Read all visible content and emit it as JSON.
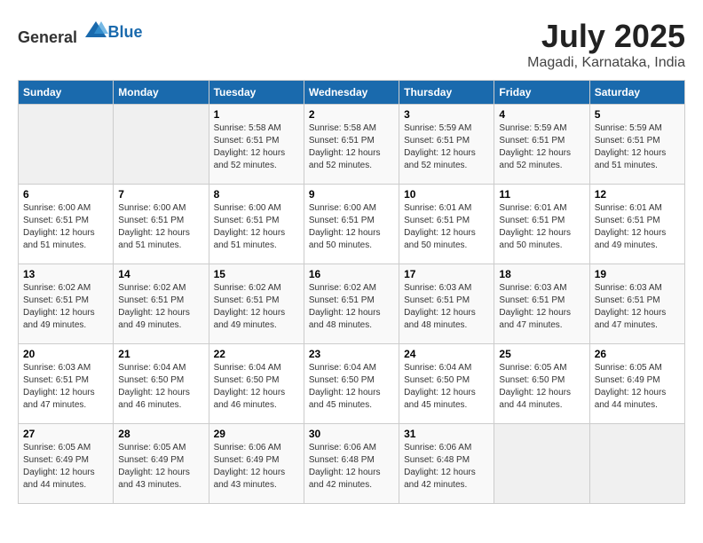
{
  "header": {
    "logo_general": "General",
    "logo_blue": "Blue",
    "title": "July 2025",
    "location": "Magadi, Karnataka, India"
  },
  "days_of_week": [
    "Sunday",
    "Monday",
    "Tuesday",
    "Wednesday",
    "Thursday",
    "Friday",
    "Saturday"
  ],
  "weeks": [
    [
      {
        "day": "",
        "empty": true
      },
      {
        "day": "",
        "empty": true
      },
      {
        "day": "1",
        "sunrise": "5:58 AM",
        "sunset": "6:51 PM",
        "daylight": "12 hours and 52 minutes."
      },
      {
        "day": "2",
        "sunrise": "5:58 AM",
        "sunset": "6:51 PM",
        "daylight": "12 hours and 52 minutes."
      },
      {
        "day": "3",
        "sunrise": "5:59 AM",
        "sunset": "6:51 PM",
        "daylight": "12 hours and 52 minutes."
      },
      {
        "day": "4",
        "sunrise": "5:59 AM",
        "sunset": "6:51 PM",
        "daylight": "12 hours and 52 minutes."
      },
      {
        "day": "5",
        "sunrise": "5:59 AM",
        "sunset": "6:51 PM",
        "daylight": "12 hours and 51 minutes."
      }
    ],
    [
      {
        "day": "6",
        "sunrise": "6:00 AM",
        "sunset": "6:51 PM",
        "daylight": "12 hours and 51 minutes."
      },
      {
        "day": "7",
        "sunrise": "6:00 AM",
        "sunset": "6:51 PM",
        "daylight": "12 hours and 51 minutes."
      },
      {
        "day": "8",
        "sunrise": "6:00 AM",
        "sunset": "6:51 PM",
        "daylight": "12 hours and 51 minutes."
      },
      {
        "day": "9",
        "sunrise": "6:00 AM",
        "sunset": "6:51 PM",
        "daylight": "12 hours and 50 minutes."
      },
      {
        "day": "10",
        "sunrise": "6:01 AM",
        "sunset": "6:51 PM",
        "daylight": "12 hours and 50 minutes."
      },
      {
        "day": "11",
        "sunrise": "6:01 AM",
        "sunset": "6:51 PM",
        "daylight": "12 hours and 50 minutes."
      },
      {
        "day": "12",
        "sunrise": "6:01 AM",
        "sunset": "6:51 PM",
        "daylight": "12 hours and 49 minutes."
      }
    ],
    [
      {
        "day": "13",
        "sunrise": "6:02 AM",
        "sunset": "6:51 PM",
        "daylight": "12 hours and 49 minutes."
      },
      {
        "day": "14",
        "sunrise": "6:02 AM",
        "sunset": "6:51 PM",
        "daylight": "12 hours and 49 minutes."
      },
      {
        "day": "15",
        "sunrise": "6:02 AM",
        "sunset": "6:51 PM",
        "daylight": "12 hours and 49 minutes."
      },
      {
        "day": "16",
        "sunrise": "6:02 AM",
        "sunset": "6:51 PM",
        "daylight": "12 hours and 48 minutes."
      },
      {
        "day": "17",
        "sunrise": "6:03 AM",
        "sunset": "6:51 PM",
        "daylight": "12 hours and 48 minutes."
      },
      {
        "day": "18",
        "sunrise": "6:03 AM",
        "sunset": "6:51 PM",
        "daylight": "12 hours and 47 minutes."
      },
      {
        "day": "19",
        "sunrise": "6:03 AM",
        "sunset": "6:51 PM",
        "daylight": "12 hours and 47 minutes."
      }
    ],
    [
      {
        "day": "20",
        "sunrise": "6:03 AM",
        "sunset": "6:51 PM",
        "daylight": "12 hours and 47 minutes."
      },
      {
        "day": "21",
        "sunrise": "6:04 AM",
        "sunset": "6:50 PM",
        "daylight": "12 hours and 46 minutes."
      },
      {
        "day": "22",
        "sunrise": "6:04 AM",
        "sunset": "6:50 PM",
        "daylight": "12 hours and 46 minutes."
      },
      {
        "day": "23",
        "sunrise": "6:04 AM",
        "sunset": "6:50 PM",
        "daylight": "12 hours and 45 minutes."
      },
      {
        "day": "24",
        "sunrise": "6:04 AM",
        "sunset": "6:50 PM",
        "daylight": "12 hours and 45 minutes."
      },
      {
        "day": "25",
        "sunrise": "6:05 AM",
        "sunset": "6:50 PM",
        "daylight": "12 hours and 44 minutes."
      },
      {
        "day": "26",
        "sunrise": "6:05 AM",
        "sunset": "6:49 PM",
        "daylight": "12 hours and 44 minutes."
      }
    ],
    [
      {
        "day": "27",
        "sunrise": "6:05 AM",
        "sunset": "6:49 PM",
        "daylight": "12 hours and 44 minutes."
      },
      {
        "day": "28",
        "sunrise": "6:05 AM",
        "sunset": "6:49 PM",
        "daylight": "12 hours and 43 minutes."
      },
      {
        "day": "29",
        "sunrise": "6:06 AM",
        "sunset": "6:49 PM",
        "daylight": "12 hours and 43 minutes."
      },
      {
        "day": "30",
        "sunrise": "6:06 AM",
        "sunset": "6:48 PM",
        "daylight": "12 hours and 42 minutes."
      },
      {
        "day": "31",
        "sunrise": "6:06 AM",
        "sunset": "6:48 PM",
        "daylight": "12 hours and 42 minutes."
      },
      {
        "day": "",
        "empty": true
      },
      {
        "day": "",
        "empty": true
      }
    ]
  ]
}
